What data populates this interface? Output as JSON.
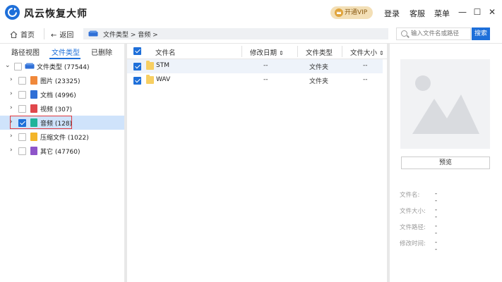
{
  "app": {
    "title": "风云恢复大师",
    "vip_label": "开通VIP",
    "login_label": "登录",
    "support_label": "客服",
    "menu_label": "菜单"
  },
  "nav": {
    "home_label": "首页",
    "back_label": "返回",
    "path": "文件类型 > 音频 >",
    "search_placeholder": "输入文件名或路径",
    "search_button": "搜索"
  },
  "left_tabs": [
    "路径视图",
    "文件类型",
    "已删除"
  ],
  "active_tab": "文件类型",
  "tree": {
    "root": {
      "label": "文件类型 (77544)",
      "checked": false
    },
    "items": [
      {
        "label": "图片 (23325)",
        "icon": "image-file-icon",
        "color": "#f0883a",
        "checked": false,
        "selected": false
      },
      {
        "label": "文档 (4996)",
        "icon": "document-file-icon",
        "color": "#2f6fd6",
        "checked": false,
        "selected": false
      },
      {
        "label": "视频 (307)",
        "icon": "video-file-icon",
        "color": "#e0474c",
        "checked": false,
        "selected": false
      },
      {
        "label": "音频 (128)",
        "icon": "audio-file-icon",
        "color": "#1fb39a",
        "checked": true,
        "selected": true
      },
      {
        "label": "压缩文件 (1022)",
        "icon": "archive-file-icon",
        "color": "#f3b52a",
        "checked": false,
        "selected": false
      },
      {
        "label": "其它 (47760)",
        "icon": "other-file-icon",
        "color": "#8e55c9",
        "checked": false,
        "selected": false
      }
    ]
  },
  "columns": [
    "文件名",
    "修改日期",
    "文件类型",
    "文件大小"
  ],
  "rows": [
    {
      "name": "STM",
      "date": "--",
      "type": "文件夹",
      "size": "--",
      "checked": true
    },
    {
      "name": "WAV",
      "date": "--",
      "type": "文件夹",
      "size": "--",
      "checked": true
    }
  ],
  "preview": {
    "button": "预览",
    "fields": [
      {
        "label": "文件名:",
        "value": "--"
      },
      {
        "label": "文件大小:",
        "value": "--"
      },
      {
        "label": "文件路径:",
        "value": "--"
      },
      {
        "label": "修改时间:",
        "value": "--"
      }
    ]
  },
  "colors": {
    "accent": "#1e6fd9",
    "selection": "#cfe3fb",
    "highlight_border": "#e0383e",
    "vip_bg": "#f3dfb6"
  }
}
